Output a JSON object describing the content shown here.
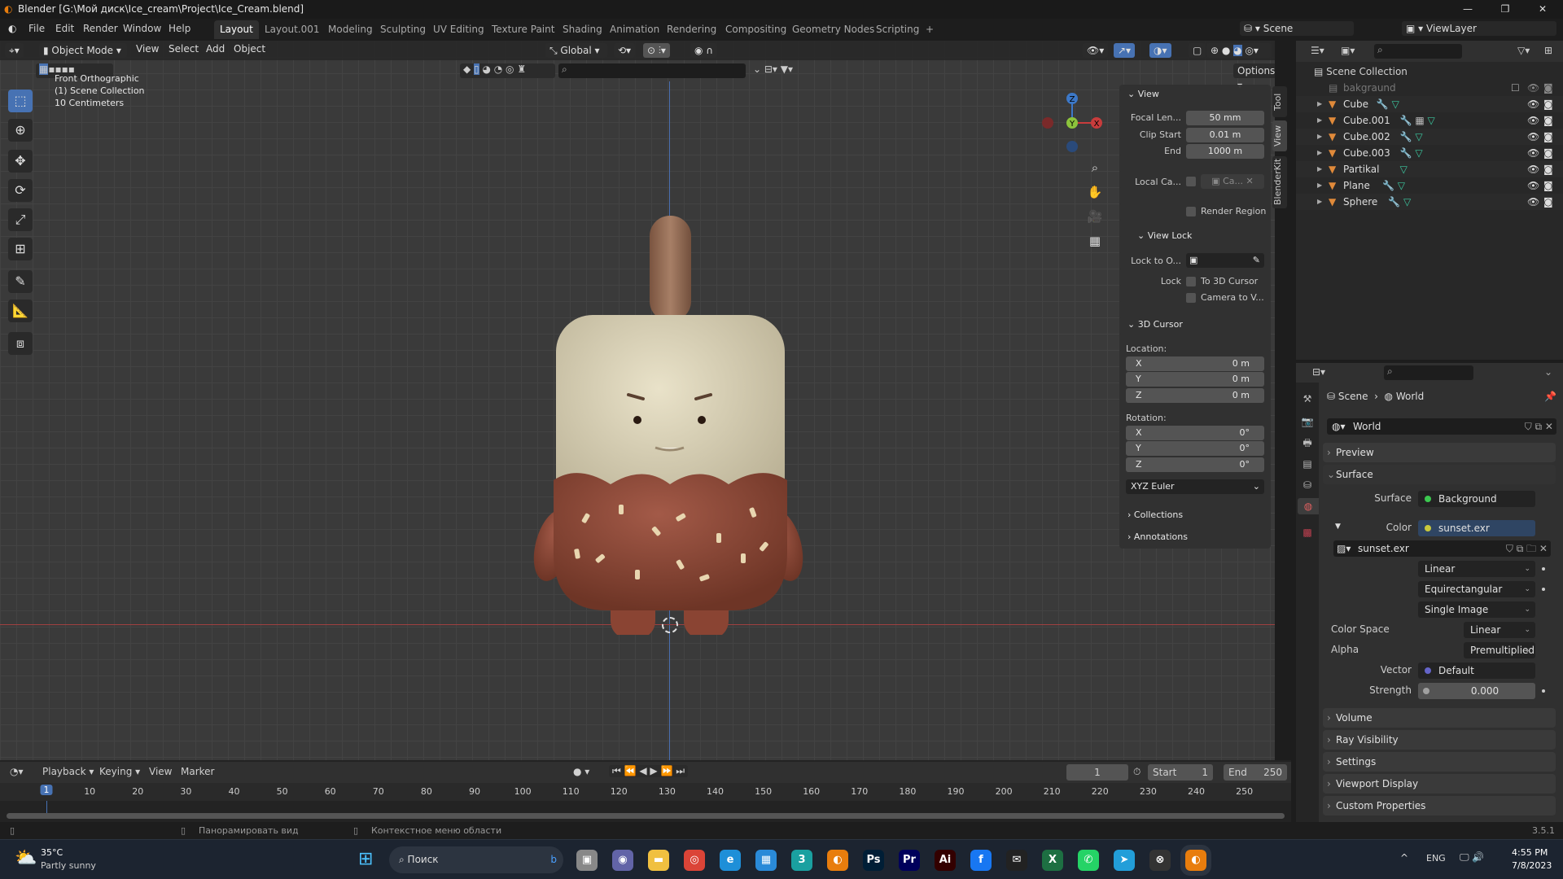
{
  "window": {
    "title": "Blender [G:\\Мой диск\\Ice_cream\\Project\\Ice_Cream.blend]",
    "controls": [
      "—",
      "❐",
      "✕"
    ]
  },
  "menu": {
    "items": [
      "File",
      "Edit",
      "Render",
      "Window",
      "Help"
    ]
  },
  "workspaces": [
    "Layout",
    "Layout.001",
    "Modeling",
    "Sculpting",
    "UV Editing",
    "Texture Paint",
    "Shading",
    "Animation",
    "Rendering",
    "Compositing",
    "Geometry Nodes",
    "Scripting",
    "+"
  ],
  "active_workspace": "Layout",
  "scene": {
    "scene_name": "Scene",
    "view_layer": "ViewLayer"
  },
  "viewport_header": {
    "mode": "Object Mode",
    "menus": [
      "View",
      "Select",
      "Add",
      "Object"
    ],
    "orientation": "Global",
    "options": "Options"
  },
  "viewport_overlay": {
    "view_name": "Front Orthographic",
    "collection": "(1) Scene Collection",
    "scale": "10 Centimeters"
  },
  "gizmo": {
    "z": "Z",
    "y": "Y",
    "x": "X"
  },
  "npanel": {
    "tabs": [
      "Tool",
      "View",
      "BlenderKit"
    ],
    "view": {
      "title": "View",
      "focal_label": "Focal Len...",
      "focal": "50 mm",
      "clip_start_label": "Clip Start",
      "clip_start": "0.01 m",
      "end_label": "End",
      "end": "1000 m",
      "local_cam_label": "Local Ca...",
      "local_cam": "Ca...",
      "render_region": "Render Region"
    },
    "view_lock": {
      "title": "View Lock",
      "lock_to_label": "Lock to O...",
      "lock_label": "Lock",
      "to_cursor": "To 3D Cursor",
      "camera_to_view": "Camera to V..."
    },
    "cursor": {
      "title": "3D Cursor",
      "location": "Location:",
      "loc": [
        {
          "axis": "X",
          "value": "0 m"
        },
        {
          "axis": "Y",
          "value": "0 m"
        },
        {
          "axis": "Z",
          "value": "0 m"
        }
      ],
      "rotation": "Rotation:",
      "rot": [
        {
          "axis": "X",
          "value": "0°"
        },
        {
          "axis": "Y",
          "value": "0°"
        },
        {
          "axis": "Z",
          "value": "0°"
        }
      ],
      "mode": "XYZ Euler"
    },
    "collections": "Collections",
    "annotations": "Annotations"
  },
  "outliner": {
    "root": "Scene Collection",
    "items": [
      {
        "name": "bakgraund",
        "type": "collection"
      },
      {
        "name": "Cube"
      },
      {
        "name": "Cube.001"
      },
      {
        "name": "Cube.002"
      },
      {
        "name": "Cube.003"
      },
      {
        "name": "Partikal"
      },
      {
        "name": "Plane"
      },
      {
        "name": "Sphere"
      }
    ]
  },
  "properties": {
    "breadcrumb": [
      "Scene",
      "World"
    ],
    "world_name": "World",
    "sections": {
      "preview": "Preview",
      "surface": "Surface",
      "volume": "Volume",
      "ray_visibility": "Ray Visibility",
      "settings": "Settings",
      "viewport_display": "Viewport Display",
      "custom_properties": "Custom Properties"
    },
    "surface_label": "Surface",
    "surface_value": "Background",
    "color_label": "Color",
    "color_value": "sunset.exr",
    "image_name": "sunset.exr",
    "interpolation": "Linear",
    "projection": "Equirectangular",
    "source": "Single Image",
    "color_space_label": "Color Space",
    "color_space": "Linear",
    "alpha_label": "Alpha",
    "alpha": "Premultiplied",
    "vector_label": "Vector",
    "vector": "Default",
    "strength_label": "Strength",
    "strength": "0.000"
  },
  "timeline": {
    "menus": [
      "Playback",
      "Keying",
      "View",
      "Marker"
    ],
    "current_frame": "1",
    "start_label": "Start",
    "start": "1",
    "end_label": "End",
    "end": "250",
    "ticks": [
      "1",
      "10",
      "20",
      "30",
      "40",
      "50",
      "60",
      "70",
      "80",
      "90",
      "100",
      "110",
      "120",
      "130",
      "140",
      "150",
      "160",
      "170",
      "180",
      "190",
      "200",
      "210",
      "220",
      "230",
      "240",
      "250"
    ]
  },
  "statusbar": {
    "hint1": "Панорамировать вид",
    "hint2": "Контекстное меню области",
    "version": "3.5.1"
  },
  "taskbar": {
    "temp": "35°C",
    "weather": "Partly sunny",
    "search": "Поиск",
    "lang": "ENG",
    "time": "4:55 PM",
    "date": "7/8/2023",
    "apps": [
      {
        "label": "▣",
        "color": "#888"
      },
      {
        "label": "◉",
        "color": "#6264a7"
      },
      {
        "label": "▬",
        "color": "#f0c040"
      },
      {
        "label": "◎",
        "color": "#db4437"
      },
      {
        "label": "e",
        "color": "#1e8fd8"
      },
      {
        "label": "▦",
        "color": "#2a8ad8"
      },
      {
        "label": "3",
        "color": "#1aa0a0"
      },
      {
        "label": "◐",
        "color": "#e87d0d"
      },
      {
        "label": "Ps",
        "color": "#001e36"
      },
      {
        "label": "Pr",
        "color": "#00005b"
      },
      {
        "label": "Ai",
        "color": "#330000"
      },
      {
        "label": "f",
        "color": "#1877f2"
      },
      {
        "label": "✉",
        "color": "#222"
      },
      {
        "label": "X",
        "color": "#1d6f42"
      },
      {
        "label": "✆",
        "color": "#25d366"
      },
      {
        "label": "➤",
        "color": "#229ed9"
      },
      {
        "label": "⊗",
        "color": "#333"
      },
      {
        "label": "◐",
        "color": "#e87d0d"
      }
    ]
  },
  "colors": {
    "accent": "#4772b3",
    "axis_x": "#c83c3c",
    "axis_y": "#8cc43c",
    "axis_z": "#3c78c8",
    "object_icon": "#e08a3a",
    "modifier_icon": "#6d86d8",
    "mesh_icon": "#3cc8a0"
  }
}
